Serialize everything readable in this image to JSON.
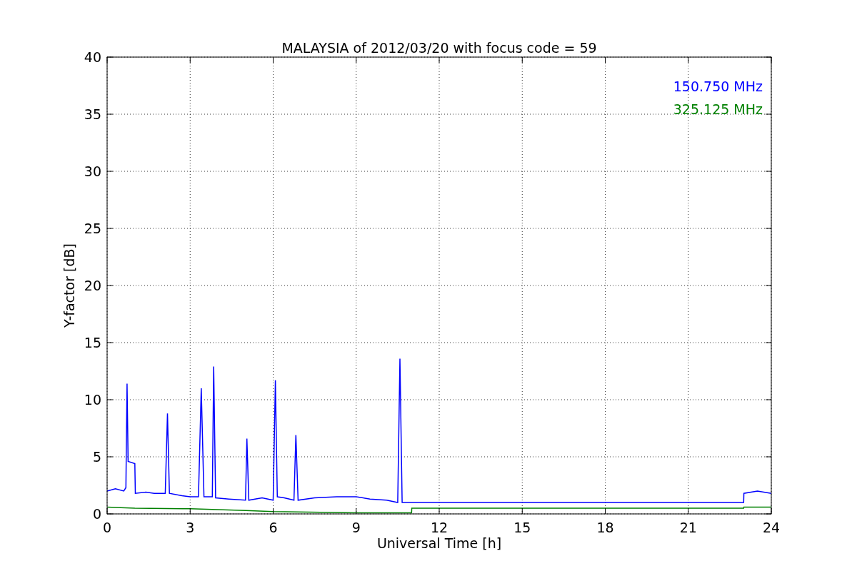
{
  "chart_data": {
    "type": "line",
    "grid": true,
    "title": "MALAYSIA of 2012/03/20 with focus code = 59",
    "xlabel": "Universal Time [h]",
    "ylabel": "Y-factor [dB]",
    "xlim": [
      0,
      24
    ],
    "ylim": [
      0,
      40
    ],
    "xticks": [
      0,
      3,
      6,
      9,
      12,
      15,
      18,
      21,
      24
    ],
    "yticks": [
      0,
      5,
      10,
      15,
      20,
      25,
      30,
      35,
      40
    ],
    "series": [
      {
        "name": "150.750 MHz",
        "color": "#0000ff",
        "x": [
          0,
          0.3,
          0.6,
          0.68,
          0.72,
          0.76,
          1.0,
          1.02,
          1.4,
          1.7,
          2.1,
          2.18,
          2.25,
          2.7,
          3.0,
          3.3,
          3.4,
          3.5,
          3.8,
          3.85,
          3.92,
          4.4,
          5.0,
          5.05,
          5.12,
          5.6,
          6.0,
          6.08,
          6.15,
          6.4,
          6.75,
          6.82,
          6.9,
          7.5,
          8.3,
          9.0,
          9.5,
          10.1,
          10.5,
          10.58,
          10.66,
          11.0,
          11.01,
          23.0,
          23.01,
          23.5,
          24.0
        ],
        "values": [
          2,
          2.2,
          2.0,
          2.3,
          11.4,
          4.6,
          4.4,
          1.8,
          1.9,
          1.8,
          1.8,
          8.8,
          1.8,
          1.6,
          1.5,
          1.5,
          11,
          1.5,
          1.5,
          12.9,
          1.4,
          1.3,
          1.2,
          6.6,
          1.2,
          1.4,
          1.2,
          11.7,
          1.5,
          1.4,
          1.2,
          6.9,
          1.2,
          1.4,
          1.5,
          1.5,
          1.3,
          1.2,
          1.0,
          13.6,
          1.0,
          1.0,
          1.0,
          1.0,
          1.8,
          2.0,
          1.8
        ]
      },
      {
        "name": "325.125 MHz",
        "color": "#008000",
        "x": [
          0,
          1,
          3,
          5,
          6,
          9,
          11,
          11.01,
          23,
          23.01,
          24
        ],
        "values": [
          0.6,
          0.5,
          0.45,
          0.3,
          0.2,
          0.1,
          0.1,
          0.5,
          0.5,
          0.6,
          0.6
        ]
      }
    ]
  }
}
